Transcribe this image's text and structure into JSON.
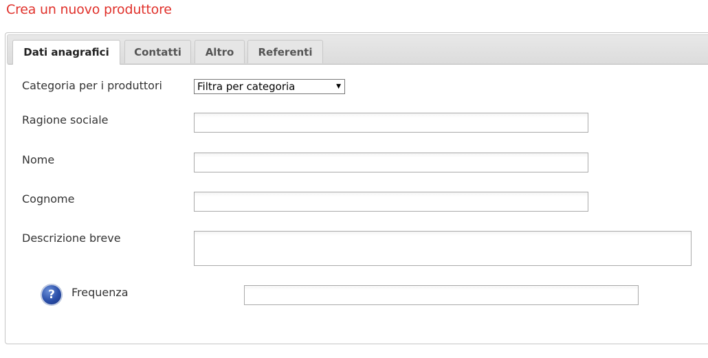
{
  "page": {
    "title": "Crea un nuovo produttore"
  },
  "tabs": [
    {
      "label": "Dati anagrafici",
      "active": true
    },
    {
      "label": "Contatti",
      "active": false
    },
    {
      "label": "Altro",
      "active": false
    },
    {
      "label": "Referenti",
      "active": false
    }
  ],
  "form": {
    "category": {
      "label": "Categoria per i produttori",
      "selected": "Filtra per categoria"
    },
    "company_name": {
      "label": "Ragione sociale",
      "value": ""
    },
    "first_name": {
      "label": "Nome",
      "value": ""
    },
    "last_name": {
      "label": "Cognome",
      "value": ""
    },
    "short_description": {
      "label": "Descrizione breve",
      "value": ""
    },
    "frequency": {
      "label": "Frequenza",
      "value": "",
      "help_icon_glyph": "?"
    }
  },
  "icons": {
    "help": "question-mark-circle-icon",
    "select_arrow": "triangle-down"
  },
  "colors": {
    "title": "#e0302a",
    "help_icon": "#2a4ea8"
  }
}
